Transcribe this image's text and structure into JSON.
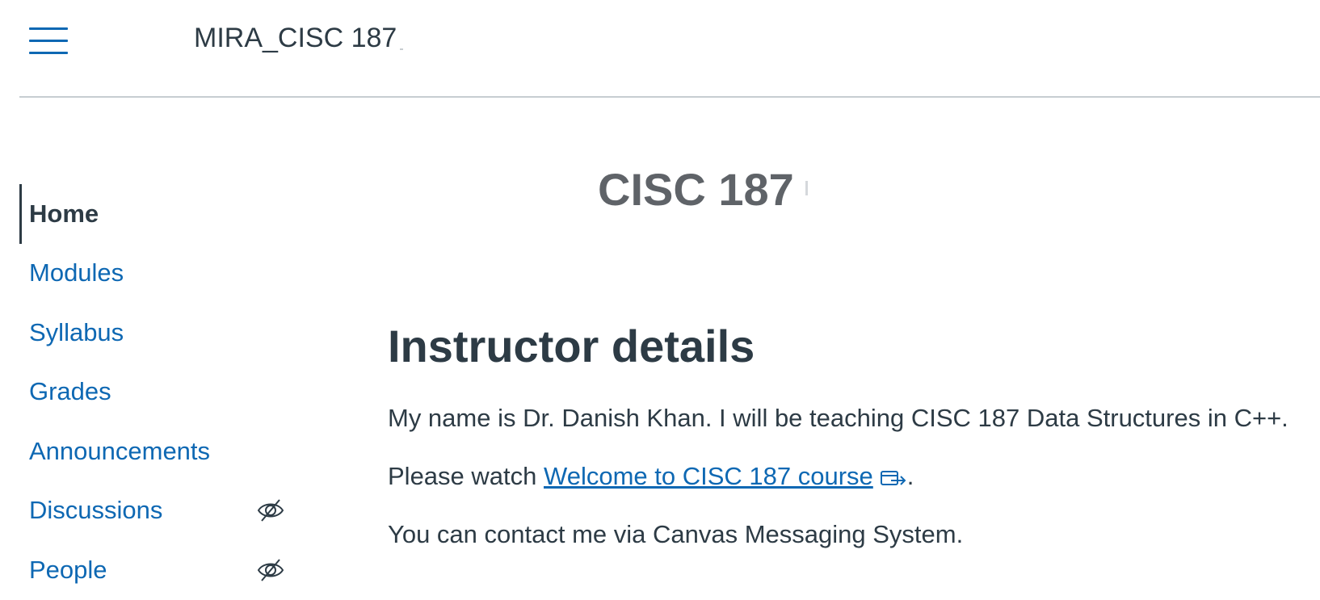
{
  "header": {
    "course_title": "MIRA_CISC 187"
  },
  "sidebar": {
    "items": [
      {
        "label": "Home",
        "active": true,
        "hidden": false
      },
      {
        "label": "Modules",
        "active": false,
        "hidden": false
      },
      {
        "label": "Syllabus",
        "active": false,
        "hidden": false
      },
      {
        "label": "Grades",
        "active": false,
        "hidden": false
      },
      {
        "label": "Announcements",
        "active": false,
        "hidden": false
      },
      {
        "label": "Discussions",
        "active": false,
        "hidden": true,
        "icon": "eye-slash-icon"
      },
      {
        "label": "People",
        "active": false,
        "hidden": true,
        "icon": "eye-slash-icon"
      }
    ]
  },
  "main": {
    "page_heading": "CISC 187",
    "section_heading": "Instructor details",
    "paragraph_1": "My name is Dr. Danish Khan. I will be teaching CISC 187 Data Structures in C++.",
    "paragraph_2_prefix": "Please watch ",
    "paragraph_2_link": "Welcome to CISC 187 course",
    "paragraph_2_suffix": ".",
    "paragraph_3": "You can contact me via Canvas Messaging System."
  },
  "colors": {
    "link": "#0e68b3",
    "text": "#2d3b45",
    "muted_heading": "#5f6368",
    "divider": "#c7cdd1"
  }
}
